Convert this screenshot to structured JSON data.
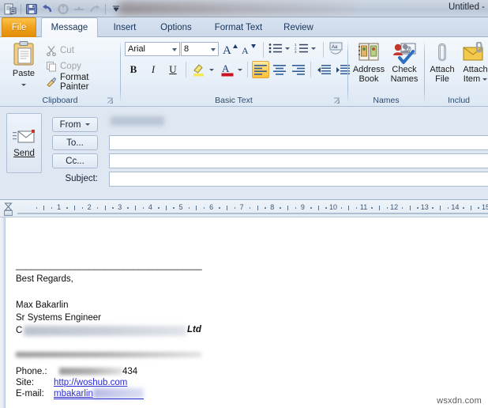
{
  "window": {
    "title": "Untitled -",
    "quick_access": [
      {
        "name": "office-app-icon",
        "glyph": "office"
      },
      {
        "name": "save-icon",
        "glyph": "save"
      },
      {
        "name": "undo-icon",
        "glyph": "undo"
      },
      {
        "name": "redo-icon",
        "glyph": "redo"
      },
      {
        "name": "previous-item-icon",
        "glyph": "prev"
      },
      {
        "name": "next-item-icon",
        "glyph": "next"
      },
      {
        "name": "customize-quick-access-toolbar-icon",
        "glyph": "chevron-down"
      }
    ]
  },
  "tabs": [
    {
      "label": "File",
      "active": false,
      "file": true
    },
    {
      "label": "Message",
      "active": true
    },
    {
      "label": "Insert",
      "active": false
    },
    {
      "label": "Options",
      "active": false
    },
    {
      "label": "Format Text",
      "active": false
    },
    {
      "label": "Review",
      "active": false
    }
  ],
  "ribbon": {
    "groups": [
      {
        "label": "Clipboard",
        "has_launcher": true
      },
      {
        "label": "Basic Text",
        "has_launcher": true
      },
      {
        "label": "Names",
        "has_launcher": false
      },
      {
        "label": "Includ",
        "has_launcher": false
      }
    ],
    "clipboard": {
      "paste_label": "Paste",
      "cut_label": "Cut",
      "copy_label": "Copy",
      "format_painter_label": "Format Painter"
    },
    "basic_text": {
      "font_name": "Arial",
      "font_size": "8",
      "bold": "B",
      "italic": "I",
      "underline": "U"
    },
    "names": {
      "address_book_line1": "Address",
      "address_book_line2": "Book",
      "check_names_line1": "Check",
      "check_names_line2": "Names"
    },
    "include": {
      "attach_file_line1": "Attach",
      "attach_file_line2": "File",
      "attach_item_line1": "Attach",
      "attach_item_line2": "Item"
    }
  },
  "envelope": {
    "send_label": "Send",
    "from_label": "From",
    "from_value": "",
    "to_label": "To...",
    "to_value": "",
    "cc_label": "Cc...",
    "cc_value": "",
    "subject_label": "Subject:",
    "subject_value": ""
  },
  "ruler": {
    "numbers": [
      "1",
      "2",
      "3",
      "4",
      "5",
      "6",
      "7",
      "8",
      "9",
      "10",
      "11",
      "12",
      "13",
      "14",
      "15"
    ]
  },
  "body": {
    "separator": "______________________________________",
    "greeting": "Best Regards,",
    "name": "Max Bakarlin",
    "job_title": "Sr Systems Engineer",
    "company_prefix": "C",
    "company_suffix": "Ltd",
    "phone_label": "Phone.:",
    "phone_value": "434",
    "site_label": "Site:",
    "site_value": "http://woshub.com",
    "email_label": "E-mail:",
    "email_value": "mbakarlin"
  },
  "watermark": "wsxdn.com",
  "colors": {
    "file_tab": "#ef9f1a",
    "ribbon_bg": "#e7eff8",
    "envelope_bg": "#dfe7f2",
    "link": "#2a2ad0",
    "highlight": "#ffd15e"
  }
}
